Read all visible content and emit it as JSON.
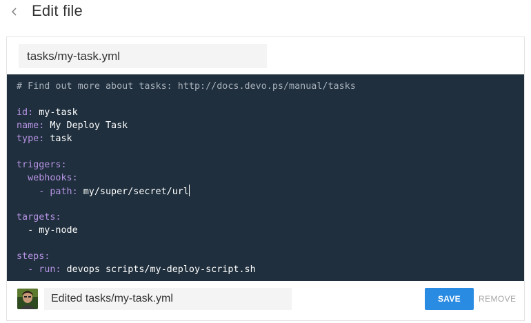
{
  "header": {
    "back_icon": "chevron-left-icon",
    "title": "Edit file"
  },
  "file": {
    "path": "tasks/my-task.yml"
  },
  "editor": {
    "lines": [
      [
        {
          "t": "# Find out more about tasks: http://docs.devo.ps/manual/tasks",
          "c": "comment"
        }
      ],
      [],
      [
        {
          "t": "id",
          "c": "key"
        },
        {
          "t": ":",
          "c": "punct"
        },
        {
          "t": " my-task",
          "c": "value"
        }
      ],
      [
        {
          "t": "name",
          "c": "key"
        },
        {
          "t": ":",
          "c": "punct"
        },
        {
          "t": " My Deploy Task",
          "c": "value"
        }
      ],
      [
        {
          "t": "type",
          "c": "key"
        },
        {
          "t": ":",
          "c": "punct"
        },
        {
          "t": " task",
          "c": "value"
        }
      ],
      [],
      [
        {
          "t": "triggers",
          "c": "key"
        },
        {
          "t": ":",
          "c": "punct"
        }
      ],
      [
        {
          "t": "  ",
          "c": "value"
        },
        {
          "t": "webhooks",
          "c": "key"
        },
        {
          "t": ":",
          "c": "punct"
        }
      ],
      [
        {
          "t": "    ",
          "c": "value"
        },
        {
          "t": "-",
          "c": "punct"
        },
        {
          "t": " ",
          "c": "value"
        },
        {
          "t": "path",
          "c": "key"
        },
        {
          "t": ":",
          "c": "punct"
        },
        {
          "t": " my/super/secret/url",
          "c": "value"
        },
        {
          "t": "",
          "c": "cursor"
        }
      ],
      [],
      [
        {
          "t": "targets",
          "c": "key"
        },
        {
          "t": ":",
          "c": "punct"
        }
      ],
      [
        {
          "t": "  - my-node",
          "c": "value"
        }
      ],
      [],
      [
        {
          "t": "steps",
          "c": "key"
        },
        {
          "t": ":",
          "c": "punct"
        }
      ],
      [
        {
          "t": "  ",
          "c": "value"
        },
        {
          "t": "-",
          "c": "punct"
        },
        {
          "t": " ",
          "c": "value"
        },
        {
          "t": "run",
          "c": "key"
        },
        {
          "t": ":",
          "c": "punct"
        },
        {
          "t": " devops scripts/my-deploy-script.sh",
          "c": "value"
        }
      ]
    ]
  },
  "footer": {
    "avatar_icon": "user-avatar",
    "commit_message": "Edited tasks/my-task.yml",
    "save_label": "SAVE",
    "remove_label": "REMOVE"
  },
  "colors": {
    "editor_bg": "#1f2f3d",
    "syntax_key": "#b894e6",
    "syntax_comment": "#a8b0ba",
    "save_button": "#2a8be2"
  }
}
